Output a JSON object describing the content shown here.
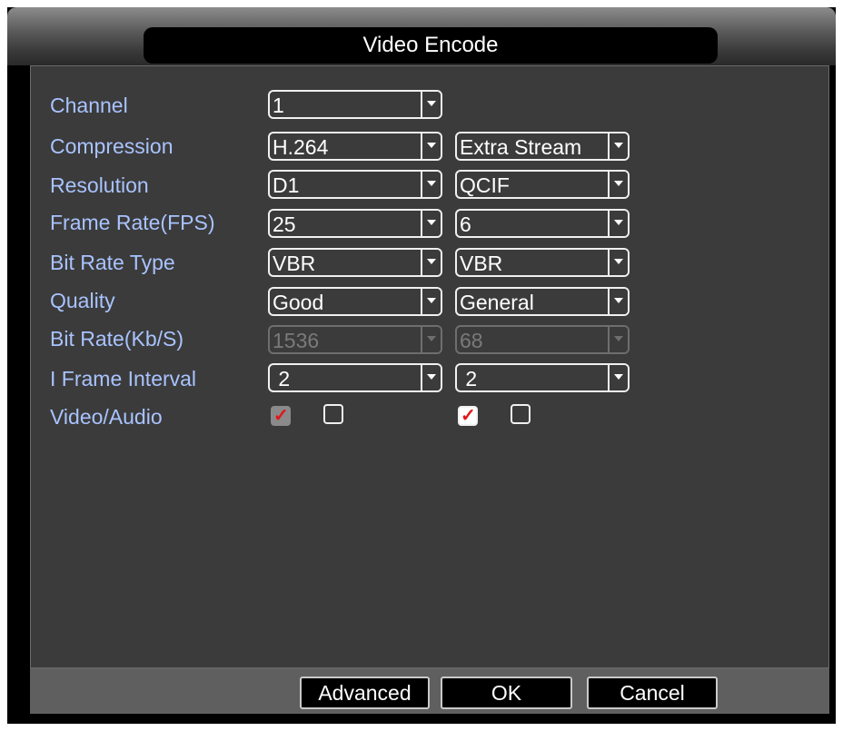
{
  "window": {
    "title": "Video Encode"
  },
  "rows": {
    "channel": {
      "label": "Channel",
      "main": "1"
    },
    "compression": {
      "label": "Compression",
      "main": "H.264",
      "extra": "Extra Stream"
    },
    "resolution": {
      "label": "Resolution",
      "main": "D1",
      "extra": "QCIF"
    },
    "frame_rate": {
      "label": "Frame Rate(FPS)",
      "main": "25",
      "extra": "6"
    },
    "bit_rate_type": {
      "label": "Bit Rate Type",
      "main": "VBR",
      "extra": "VBR"
    },
    "quality": {
      "label": "Quality",
      "main": "Good",
      "extra": "General"
    },
    "bit_rate": {
      "label": "Bit Rate(Kb/S)",
      "main": "1536",
      "extra": "68"
    },
    "i_frame_interval": {
      "label": "I Frame Interval",
      "main": " 2",
      "extra": " 2"
    },
    "video_audio": {
      "label": "Video/Audio",
      "main_video_checked": true,
      "main_audio_checked": false,
      "extra_video_checked": true,
      "extra_audio_checked": false
    }
  },
  "buttons": {
    "advanced": "Advanced",
    "ok": "OK",
    "cancel": "Cancel"
  },
  "colors": {
    "label": "#a9c3ff",
    "panel": "#3b3b3b",
    "check": "#e0161a"
  }
}
